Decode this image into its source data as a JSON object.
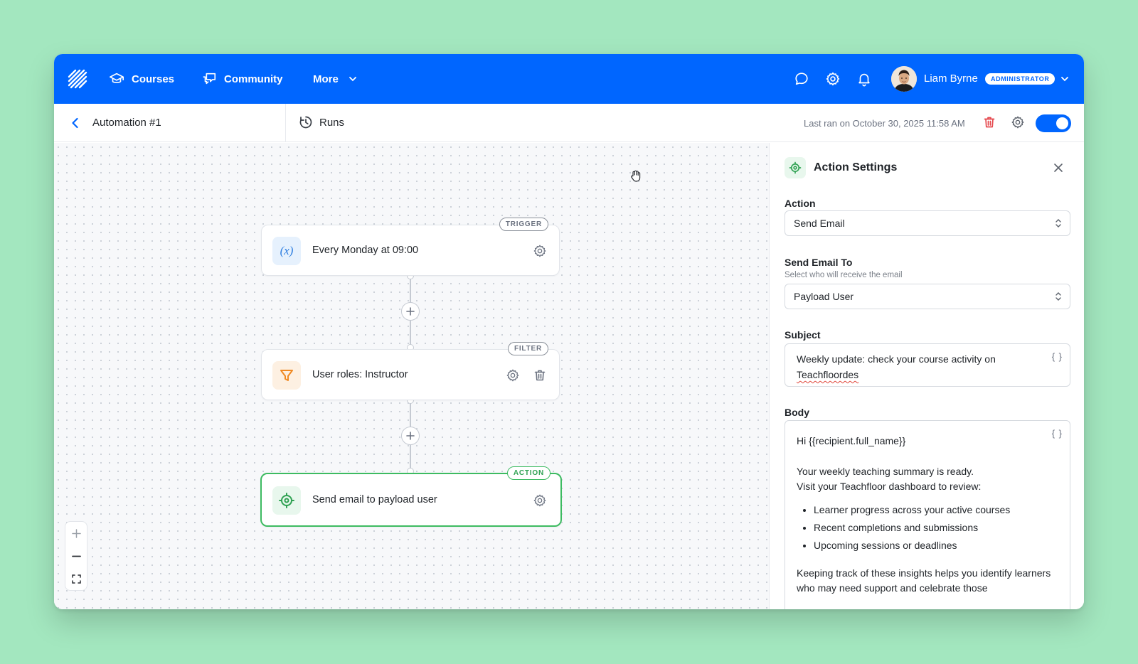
{
  "nav": {
    "courses": "Courses",
    "community": "Community",
    "more": "More",
    "user_name": "Liam Byrne",
    "role_badge": "ADMINISTRATOR"
  },
  "subheader": {
    "title": "Automation #1",
    "runs": "Runs",
    "last_ran": "Last ran on October 30, 2025 11:58 AM",
    "enabled": true
  },
  "canvas": {
    "nodes": [
      {
        "badge": "TRIGGER",
        "label": "Every Monday at 09:00",
        "icon": "variable-icon"
      },
      {
        "badge": "FILTER",
        "label": "User roles: Instructor",
        "icon": "filter-icon"
      },
      {
        "badge": "ACTION",
        "label": "Send email to payload user",
        "icon": "target-icon"
      }
    ]
  },
  "panel": {
    "title": "Action Settings",
    "action_label": "Action",
    "action_value": "Send Email",
    "send_to_label": "Send Email To",
    "send_to_help": "Select who will receive the email",
    "send_to_value": "Payload User",
    "subject_label": "Subject",
    "subject_value_prefix": "Weekly update: check your course activity on",
    "subject_value_brand": "Teachfloordes",
    "body_label": "Body",
    "braces": "{ }",
    "body": {
      "greeting": "Hi {{recipient.full_name}}",
      "line1": "Your weekly teaching summary is ready.",
      "line2": "Visit your Teachfloor dashboard to review:",
      "bullets": [
        "Learner progress across your active courses",
        "Recent completions and submissions",
        "Upcoming sessions or deadlines"
      ],
      "closing": "Keeping track of these insights helps you identify learners who may need support and celebrate those"
    }
  },
  "colors": {
    "brand_blue": "#0066ff",
    "action_green": "#3dbb61",
    "delete_red": "#e5484d"
  }
}
